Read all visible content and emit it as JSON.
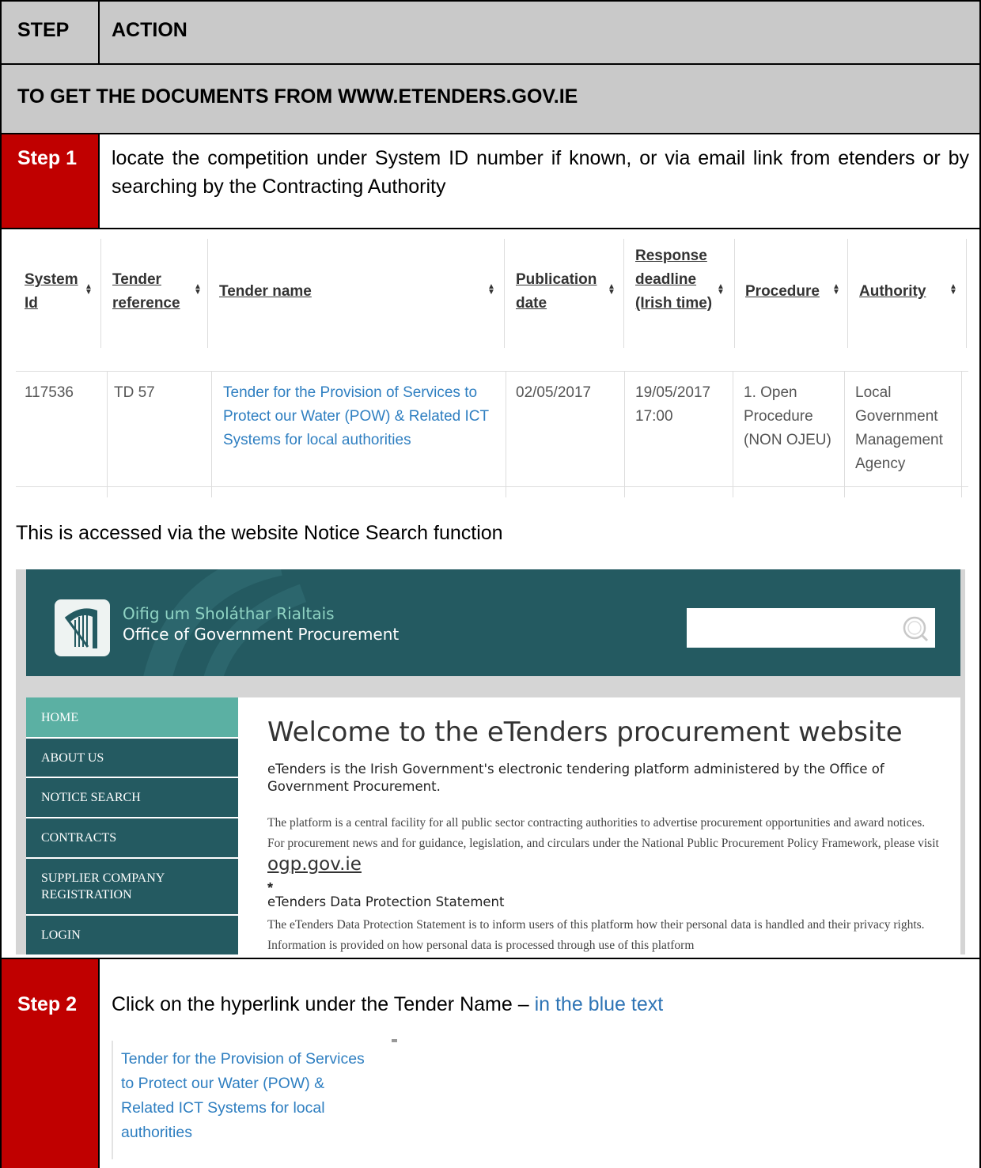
{
  "header": {
    "step": "STEP",
    "action": "ACTION"
  },
  "section": {
    "title": "TO GET THE DOCUMENTS FROM WWW.ETENDERS.GOV.IE"
  },
  "step1": {
    "label": "Step 1",
    "text": "locate the competition under System ID number if known, or via email link from etenders or by searching by the Contracting Authority"
  },
  "tender_table": {
    "headers": [
      "System Id",
      "Tender reference",
      "Tender name",
      "Publication date",
      "Response deadline (Irish time)",
      "Procedure",
      "Authority"
    ],
    "sort_icon": "sort-arrows-icon",
    "row": {
      "system_id": "117536",
      "reference": "TD 57",
      "name": "Tender for the Provision of Services to Protect our Water (POW) & Related ICT Systems for local authorities",
      "publication_date": "02/05/2017",
      "deadline": "19/05/2017 17:00",
      "procedure": "1. Open Procedure (NON OJEU)",
      "authority": "Local Government Management Agency"
    }
  },
  "access_note": "This is accessed via the website Notice Search function",
  "website": {
    "org_irish": "Oifig um Sholáthar Rialtais",
    "org_english": "Office of Government Procurement",
    "logo_icon": "harp-icon",
    "search_icon": "magnifier-icon",
    "nav": [
      "HOME",
      "ABOUT US",
      "NOTICE SEARCH",
      "CONTRACTS",
      "SUPPLIER COMPANY REGISTRATION",
      "LOGIN"
    ],
    "welcome": "Welcome to the eTenders procurement website",
    "lead": "eTenders is the Irish Government's electronic tendering platform administered by the Office of Government Procurement.",
    "paragraph": "The platform is a central facility for all public sector contracting authorities to advertise procurement opportunities and award notices. For procurement news and for guidance, legislation, and circulars under the National Public Procurement Policy Framework, please visit",
    "paragraph_link": "ogp.gov.ie",
    "star": "*",
    "dps_title": "eTenders Data Protection Statement",
    "dps_text": "The eTenders Data Protection Statement is to inform users of this platform how their personal data is handled and their privacy rights. Information is provided on how personal data is processed through use of this platform"
  },
  "step2": {
    "label": "Step 2",
    "text": "Click on the hyperlink under the Tender Name –",
    "text_blue": "in the blue text",
    "link_lines": [
      "Tender for the Provision of Services",
      "to Protect our Water (POW) &",
      "Related ICT Systems for local",
      "authorities"
    ]
  }
}
